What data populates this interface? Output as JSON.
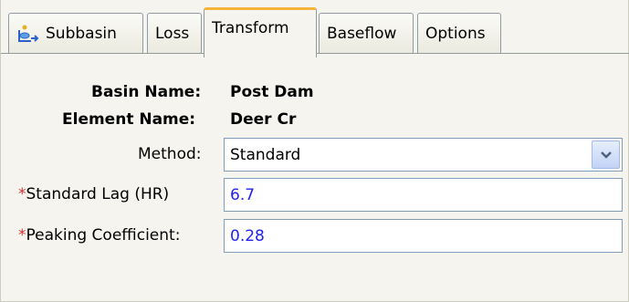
{
  "tabs": [
    {
      "label": "Subbasin",
      "icon": "subbasin-icon"
    },
    {
      "label": "Loss"
    },
    {
      "label": "Transform",
      "active": true
    },
    {
      "label": "Baseflow"
    },
    {
      "label": "Options"
    }
  ],
  "form": {
    "basin_label": "Basin Name:",
    "basin_value": "Post Dam",
    "element_label": "Element Name:",
    "element_value": "Deer Cr",
    "method_label": "Method:",
    "method_value": "Standard",
    "lag_label": "Standard Lag (HR)",
    "lag_value": "6.7",
    "peaking_label": "Peaking Coefficient:",
    "peaking_value": "0.28",
    "required_marker": "*"
  },
  "colors": {
    "active_tab_accent": "#f6b43a",
    "numeric_value": "#2222ee",
    "required_marker": "#d63030"
  }
}
